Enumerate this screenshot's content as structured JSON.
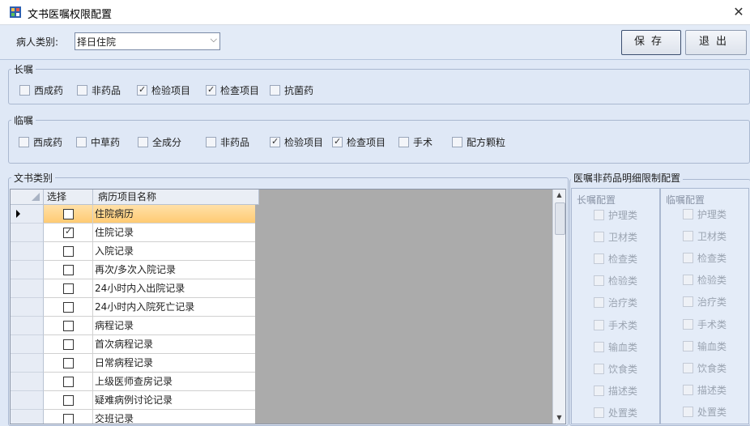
{
  "window": {
    "title": "文书医嘱权限配置",
    "close_symbol": "✕"
  },
  "topbar": {
    "patient_type_label": "病人类别:",
    "patient_type_value": "择日住院",
    "save_label": "保存",
    "exit_label": "退出"
  },
  "long_term": {
    "title": "长嘱",
    "items": [
      {
        "label": "西成药",
        "checked": false
      },
      {
        "label": "非药品",
        "checked": false
      },
      {
        "label": "检验项目",
        "checked": true
      },
      {
        "label": "检查项目",
        "checked": true
      },
      {
        "label": "抗菌药",
        "checked": false
      }
    ]
  },
  "temporary": {
    "title": "临嘱",
    "items": [
      {
        "label": "西成药",
        "checked": false
      },
      {
        "label": "中草药",
        "checked": false
      },
      {
        "label": "全成分",
        "checked": false
      },
      {
        "label": "非药品",
        "checked": false
      },
      {
        "label": "检验项目",
        "checked": true
      },
      {
        "label": "检查项目",
        "checked": true
      },
      {
        "label": "手术",
        "checked": false
      },
      {
        "label": "配方颗粒",
        "checked": false
      }
    ]
  },
  "doc_types": {
    "title": "文书类别",
    "columns": {
      "select": "选择",
      "name": "病历项目名称"
    },
    "rows": [
      {
        "name": "住院病历",
        "checked": false,
        "selected": true
      },
      {
        "name": "住院记录",
        "checked": true,
        "selected": false
      },
      {
        "name": "入院记录",
        "checked": false,
        "selected": false
      },
      {
        "name": "再次/多次入院记录",
        "checked": false,
        "selected": false
      },
      {
        "name": "24小时内入出院记录",
        "checked": false,
        "selected": false
      },
      {
        "name": "24小时内入院死亡记录",
        "checked": false,
        "selected": false
      },
      {
        "name": "病程记录",
        "checked": false,
        "selected": false
      },
      {
        "name": "首次病程记录",
        "checked": false,
        "selected": false
      },
      {
        "name": "日常病程记录",
        "checked": false,
        "selected": false
      },
      {
        "name": "上级医师查房记录",
        "checked": false,
        "selected": false
      },
      {
        "name": "疑难病例讨论记录",
        "checked": false,
        "selected": false
      },
      {
        "name": "交班记录",
        "checked": false,
        "selected": false
      }
    ]
  },
  "nondrug": {
    "title": "医嘱非药品明细限制配置",
    "long_title": "长嘱配置",
    "temp_title": "临嘱配置",
    "long_items": [
      "护理类",
      "卫材类",
      "检查类",
      "检验类",
      "治疗类",
      "手术类",
      "输血类",
      "饮食类",
      "描述类",
      "处置类"
    ],
    "temp_items": [
      "护理类",
      "卫材类",
      "检查类",
      "检验类",
      "治疗类",
      "手术类",
      "输血类",
      "饮食类",
      "描述类",
      "处置类"
    ]
  },
  "colors": {
    "selected_row": "#ffcb73",
    "grid_bg": "#ababab",
    "panel_bg": "#dfe8f6"
  }
}
